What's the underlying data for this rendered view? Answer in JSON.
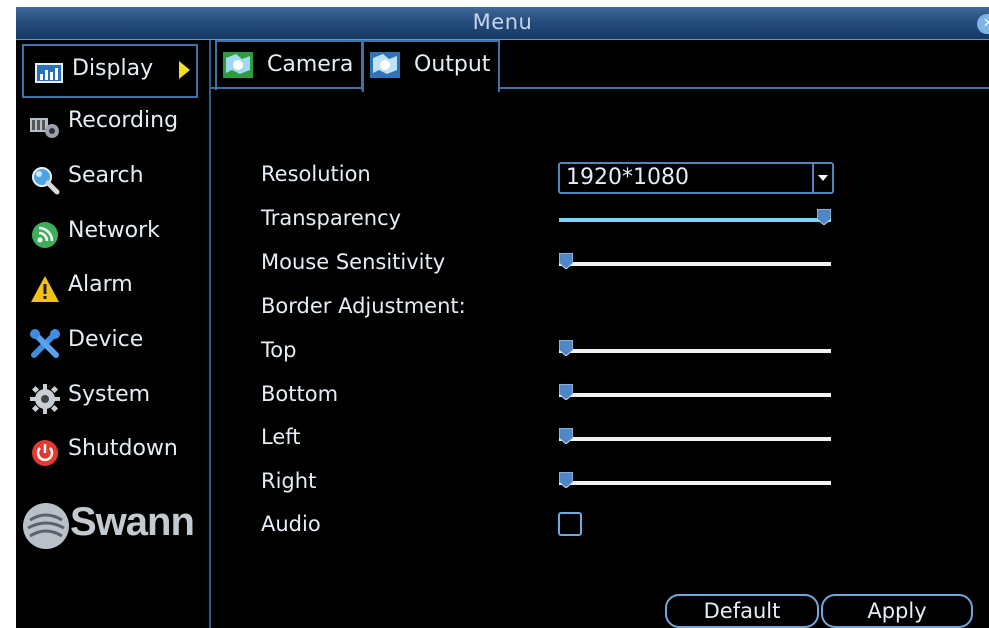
{
  "window": {
    "title": "Menu",
    "close_icon": "close-icon"
  },
  "sidebar": {
    "items": [
      {
        "label": "Display",
        "icon": "display-icon",
        "active": true
      },
      {
        "label": "Recording",
        "icon": "recording-icon"
      },
      {
        "label": "Search",
        "icon": "search-icon"
      },
      {
        "label": "Network",
        "icon": "network-icon"
      },
      {
        "label": "Alarm",
        "icon": "alarm-icon"
      },
      {
        "label": "Device",
        "icon": "device-icon"
      },
      {
        "label": "System",
        "icon": "system-icon"
      },
      {
        "label": "Shutdown",
        "icon": "shutdown-icon"
      }
    ],
    "logo_text": "Swann"
  },
  "tabs": [
    {
      "label": "Camera",
      "active": false
    },
    {
      "label": "Output",
      "active": true
    }
  ],
  "settings": {
    "resolution": {
      "label": "Resolution",
      "value": "1920*1080"
    },
    "transparency": {
      "label": "Transparency",
      "level": 1.0
    },
    "mouse_sensitivity": {
      "label": "Mouse Sensitivity",
      "level": 0.0
    },
    "border_adjustment": {
      "label": "Border Adjustment:"
    },
    "top": {
      "label": "Top",
      "level": 0.0
    },
    "bottom": {
      "label": "Bottom",
      "level": 0.0
    },
    "left": {
      "label": "Left",
      "level": 0.0
    },
    "right": {
      "label": "Right",
      "level": 0.0
    },
    "audio": {
      "label": "Audio",
      "checked": false
    }
  },
  "buttons": {
    "default_label": "Default",
    "apply_label": "Apply"
  },
  "colors": {
    "accent": "#3f73a8",
    "slider_fill": "#7fd4f4",
    "arrow": "#f3e020"
  }
}
